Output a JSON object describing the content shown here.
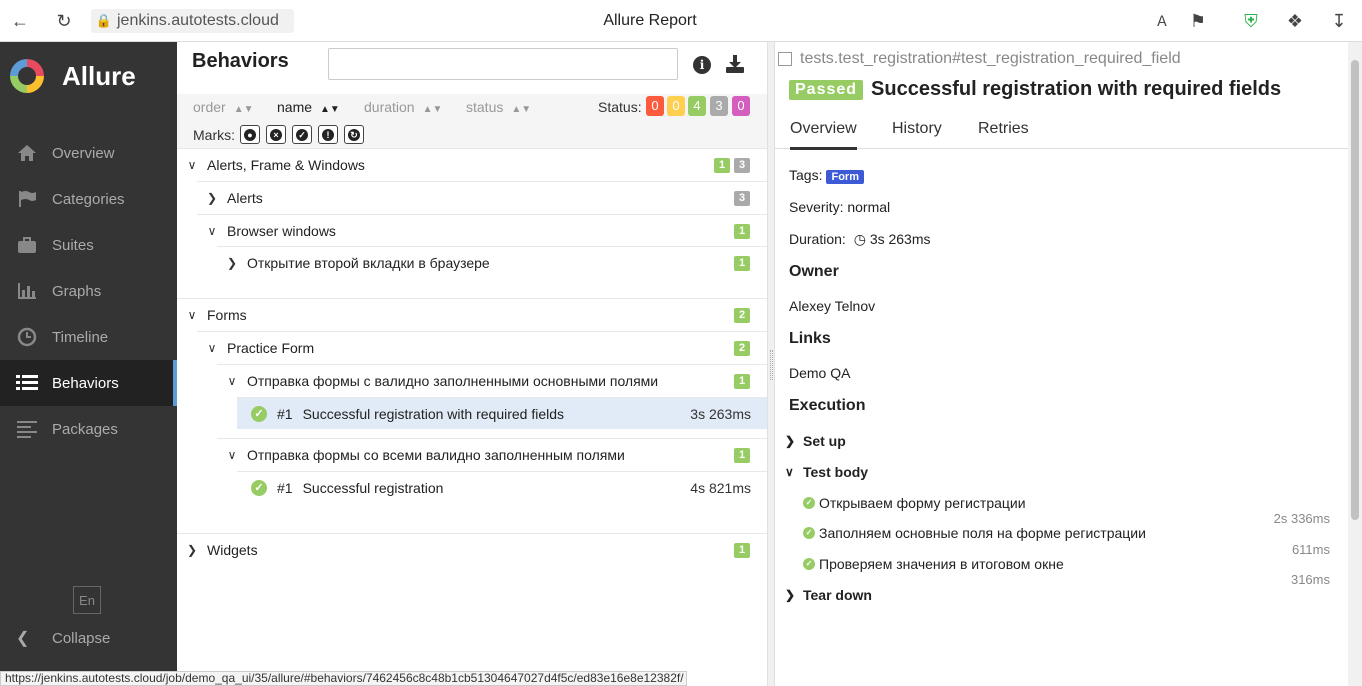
{
  "browser": {
    "url": "jenkins.autotests.cloud",
    "window_title": "Allure Report",
    "status_url": "https://jenkins.autotests.cloud/job/demo_qa_ui/35/allure/#behaviors/7462456c8c48b1cb51304647027d4f5c/ed83e16e8e12382f/"
  },
  "sidebar": {
    "logo_text": "Allure",
    "items": [
      {
        "label": "Overview",
        "icon": "home-icon"
      },
      {
        "label": "Categories",
        "icon": "flag-icon"
      },
      {
        "label": "Suites",
        "icon": "briefcase-icon"
      },
      {
        "label": "Graphs",
        "icon": "bar-chart-icon"
      },
      {
        "label": "Timeline",
        "icon": "clock-icon"
      },
      {
        "label": "Behaviors",
        "icon": "list-icon",
        "active": true
      },
      {
        "label": "Packages",
        "icon": "align-left-icon"
      }
    ],
    "lang": "En",
    "collapse": "Collapse"
  },
  "behaviors": {
    "title": "Behaviors",
    "search_placeholder": "",
    "sort": {
      "order": "order",
      "name": "name",
      "duration": "duration",
      "status": "status"
    },
    "status_label": "Status:",
    "status_counts": [
      {
        "value": "0",
        "color": "#fd5a3e"
      },
      {
        "value": "0",
        "color": "#ffd050"
      },
      {
        "value": "4",
        "color": "#97cc64"
      },
      {
        "value": "3",
        "color": "#aaaaaa"
      },
      {
        "value": "0",
        "color": "#d35ebe"
      }
    ],
    "marks_label": "Marks:",
    "tree": {
      "alerts_frame": {
        "label": "Alerts, Frame & Windows",
        "c1": "1",
        "c2": "3"
      },
      "alerts": {
        "label": "Alerts",
        "c": "3"
      },
      "browser_windows": {
        "label": "Browser windows",
        "c": "1"
      },
      "second_tab": {
        "label": "Открытие второй вкладки в браузере",
        "c": "1"
      },
      "forms": {
        "label": "Forms",
        "c": "2"
      },
      "practice_form": {
        "label": "Practice Form",
        "c": "2"
      },
      "story1": {
        "label": "Отправка формы с валидно заполненными основными полями",
        "c": "1"
      },
      "test1": {
        "num": "#1",
        "label": "Successful registration with required fields",
        "duration": "3s 263ms"
      },
      "story2": {
        "label": "Отправка формы со всеми валидно заполненным полями",
        "c": "1"
      },
      "test2": {
        "num": "#1",
        "label": "Successful registration",
        "duration": "4s 821ms"
      },
      "widgets": {
        "label": "Widgets",
        "c": "1"
      }
    }
  },
  "detail": {
    "crumb": "tests.test_registration#test_registration_required_field",
    "status": "Passed",
    "title": "Successful registration with required fields",
    "tabs": [
      "Overview",
      "History",
      "Retries"
    ],
    "tags_label": "Tags:",
    "tag": "Form",
    "severity": "Severity: normal",
    "duration_label": "Duration:",
    "duration": "3s 263ms",
    "owner_h": "Owner",
    "owner": "Alexey Telnov",
    "links_h": "Links",
    "link": "Demo QA",
    "execution_h": "Execution",
    "setup": "Set up",
    "test_body": "Test body",
    "steps": [
      {
        "label": "Открываем форму регистрации",
        "duration": "2s 336ms"
      },
      {
        "label": "Заполняем основные поля на форме регистрации",
        "duration": "611ms"
      },
      {
        "label": "Проверяем значения в итоговом окне",
        "duration": "316ms"
      }
    ],
    "teardown": "Tear down"
  }
}
